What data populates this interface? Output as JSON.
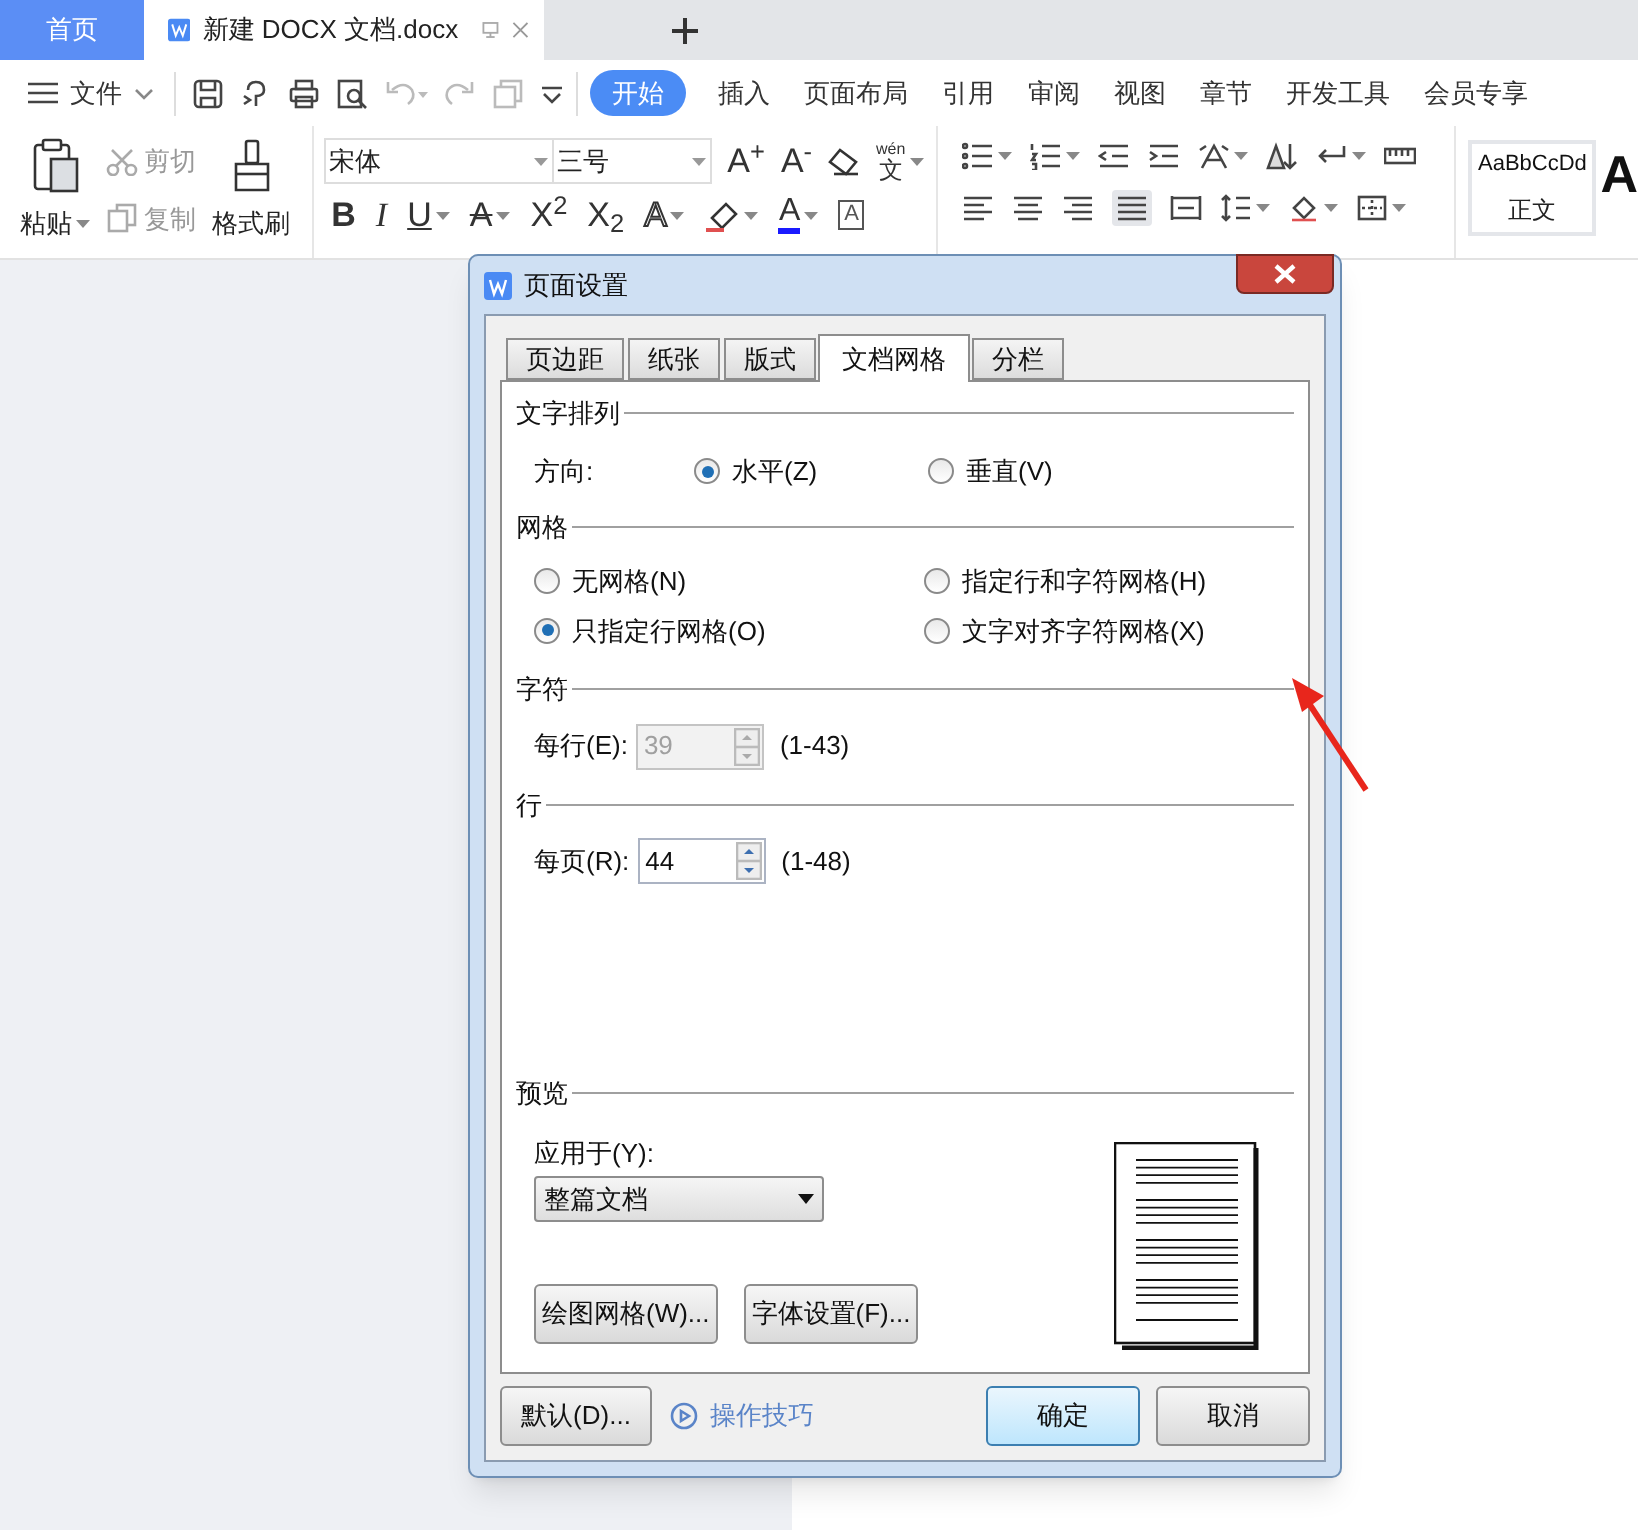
{
  "app_tabs": [
    {
      "label": "首页",
      "kind": "home"
    },
    {
      "label": "新建 DOCX 文档.docx",
      "kind": "document"
    }
  ],
  "menu": {
    "file": "文件",
    "tabs": [
      {
        "label": "开始",
        "selected": true
      },
      {
        "label": "插入",
        "selected": false
      },
      {
        "label": "页面布局",
        "selected": false
      },
      {
        "label": "引用",
        "selected": false
      },
      {
        "label": "审阅",
        "selected": false
      },
      {
        "label": "视图",
        "selected": false
      },
      {
        "label": "章节",
        "selected": false
      },
      {
        "label": "开发工具",
        "selected": false
      },
      {
        "label": "会员专享",
        "selected": false
      }
    ]
  },
  "ribbon": {
    "paste": "粘贴",
    "cut": "剪切",
    "copy": "复制",
    "format_painter": "格式刷",
    "font": "宋体",
    "size": "三号",
    "grow": "A$^{+}$",
    "shrink": "A$^{-}$",
    "pinyin_top": "wén",
    "pinyin_char": "文",
    "format_buttons": [
      {
        "text": "B",
        "kind": "bold"
      },
      {
        "text": "I",
        "kind": "italic"
      },
      {
        "text": "U",
        "kind": "underline"
      },
      {
        "text": "A",
        "kind": "strike"
      },
      {
        "text": "X$^{2}$",
        "kind": "plain"
      },
      {
        "text": "X$_{2}$",
        "kind": "plain"
      },
      {
        "text": "A",
        "kind": "outline"
      }
    ],
    "font_color": "A",
    "char_border": "A",
    "style_preview": "AaBbCcDd",
    "style_name": "正文",
    "style_preview_2": "A"
  },
  "dialog": {
    "title": "页面设置",
    "tabs": [
      {
        "label": "页边距",
        "selected": false
      },
      {
        "label": "纸张",
        "selected": false
      },
      {
        "label": "版式",
        "selected": false
      },
      {
        "label": "文档网格",
        "selected": true
      },
      {
        "label": "分栏",
        "selected": false
      }
    ],
    "text_direction": {
      "heading": "文字排列",
      "label": "方向:",
      "options": [
        {
          "label": "水平(Z)",
          "selected": true
        },
        {
          "label": "垂直(V)",
          "selected": false
        }
      ]
    },
    "grid": {
      "heading": "网格",
      "options": [
        {
          "label": "无网格(N)",
          "selected": false
        },
        {
          "label": "指定行和字符网格(H)",
          "selected": false
        },
        {
          "label": "只指定行网格(O)",
          "selected": true
        },
        {
          "label": "文字对齐字符网格(X)",
          "selected": false
        }
      ]
    },
    "characters": {
      "heading": "字符",
      "label": "每行(E):",
      "value": "39",
      "range": "(1-43)",
      "disabled": true
    },
    "lines": {
      "heading": "行",
      "label": "每页(R):",
      "value": "44",
      "range": "(1-48)",
      "disabled": false
    },
    "preview": {
      "heading": "预览",
      "apply_label": "应用于(Y):",
      "apply_value": "整篇文档",
      "buttons": [
        "绘图网格(W)...",
        "字体设置(F)..."
      ]
    },
    "footer": {
      "default_button": "默认(D)...",
      "tips_link": "操作技巧",
      "ok": "确定",
      "cancel": "取消"
    }
  }
}
